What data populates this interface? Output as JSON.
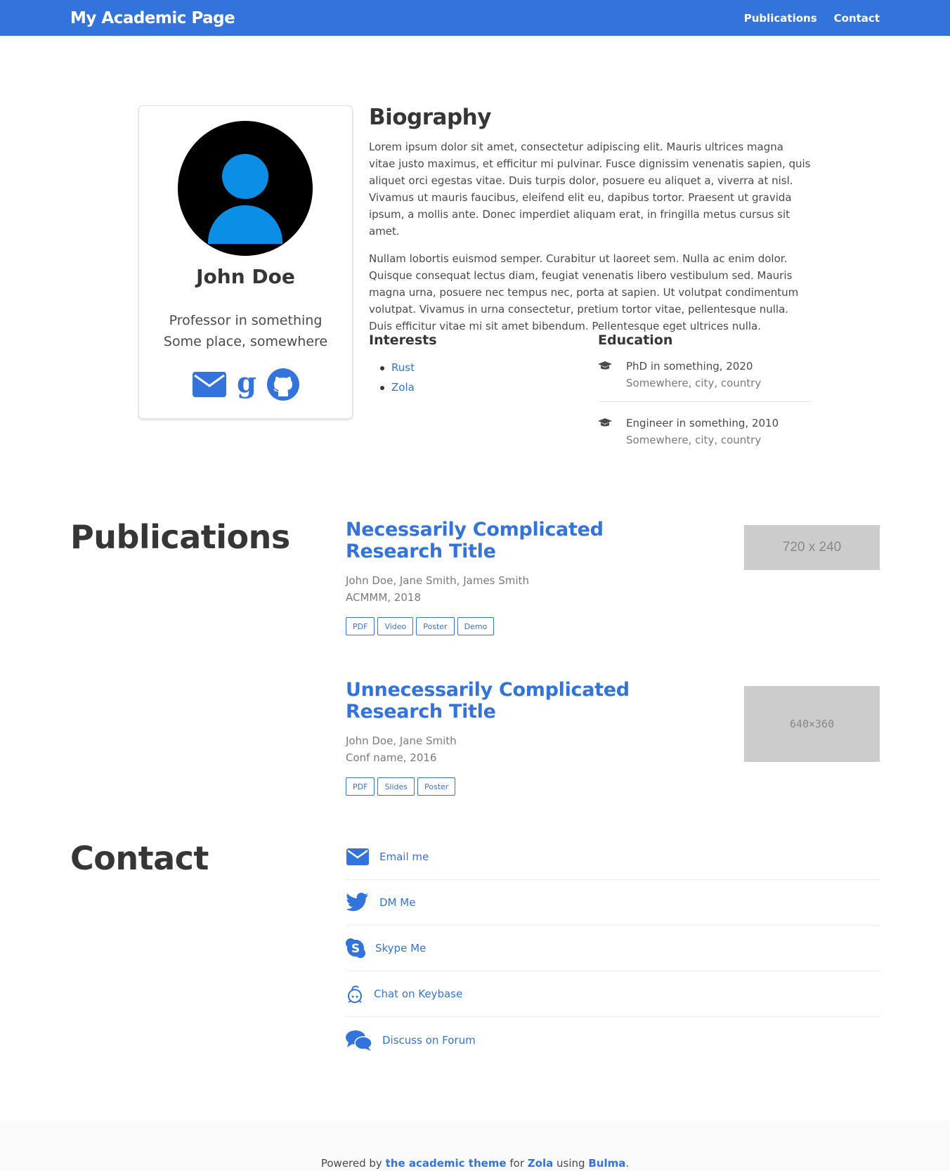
{
  "navbar": {
    "brand": "My Academic Page",
    "links": [
      "Publications",
      "Contact"
    ]
  },
  "profile": {
    "name": "John Doe",
    "title": "Professor in something",
    "place": "Some place, somewhere",
    "icons": [
      "envelope-icon",
      "google-scholar-icon",
      "github-icon"
    ]
  },
  "biography": {
    "heading": "Biography",
    "paragraphs": [
      "Lorem ipsum dolor sit amet, consectetur adipiscing elit. Mauris ultrices magna vitae justo maximus, et efficitur mi pulvinar. Fusce dignissim venenatis sapien, quis aliquet orci egestas vitae. Duis turpis dolor, posuere eu aliquet a, viverra at nisl. Vivamus ut mauris faucibus, eleifend elit eu, dapibus tortor. Praesent ut gravida ipsum, a mollis ante. Donec imperdiet aliquam erat, in fringilla metus cursus sit amet.",
      "Nullam lobortis euismod semper. Curabitur ut laoreet sem. Nulla ac enim dolor. Quisque consequat lectus diam, feugiat venenatis libero vestibulum sed. Mauris magna urna, posuere nec tempus nec, porta at sapien. Ut volutpat condimentum volutpat. Vivamus in urna consectetur, pretium tortor vitae, pellentesque nulla. Duis efficitur vitae mi sit amet bibendum. Pellentesque eget ultrices nulla."
    ]
  },
  "interests": {
    "heading": "Interests",
    "items": [
      "Rust",
      "Zola"
    ]
  },
  "education": {
    "heading": "Education",
    "items": [
      {
        "degree": "PhD in something, 2020",
        "place": "Somewhere, city, country"
      },
      {
        "degree": "Engineer in something, 2010",
        "place": "Somewhere, city, country"
      }
    ]
  },
  "publications": {
    "heading": "Publications",
    "items": [
      {
        "title": "Necessarily Complicated Research Title",
        "authors": "John Doe, Jane Smith, James Smith",
        "venue": "ACMMM, 2018",
        "tags": [
          "PDF",
          "Video",
          "Poster",
          "Demo"
        ],
        "thumb_label": "720 x 240"
      },
      {
        "title": "Unnecessarily Complicated Research Title",
        "authors": "John Doe, Jane Smith",
        "venue": "Conf name, 2016",
        "tags": [
          "PDF",
          "Slides",
          "Poster"
        ],
        "thumb_label": "640×360"
      }
    ]
  },
  "contact": {
    "heading": "Contact",
    "items": [
      {
        "icon": "envelope-icon",
        "label": "Email me"
      },
      {
        "icon": "twitter-icon",
        "label": "DM Me"
      },
      {
        "icon": "skype-icon",
        "label": "Skype Me"
      },
      {
        "icon": "keybase-icon",
        "label": "Chat on Keybase"
      },
      {
        "icon": "comments-icon",
        "label": "Discuss on Forum"
      }
    ]
  },
  "footer": {
    "prefix": "Powered by",
    "link1": "the academic theme",
    "mid1": "for",
    "link2": "Zola",
    "mid2": "using",
    "link3": "Bulma",
    "suffix": "."
  },
  "colors": {
    "accent": "#3273dc",
    "avatar_bg": "#000000",
    "avatar_fg": "#0a8ee6",
    "thumb_bg": "#cccccc",
    "footer_bg": "#fafafa"
  }
}
